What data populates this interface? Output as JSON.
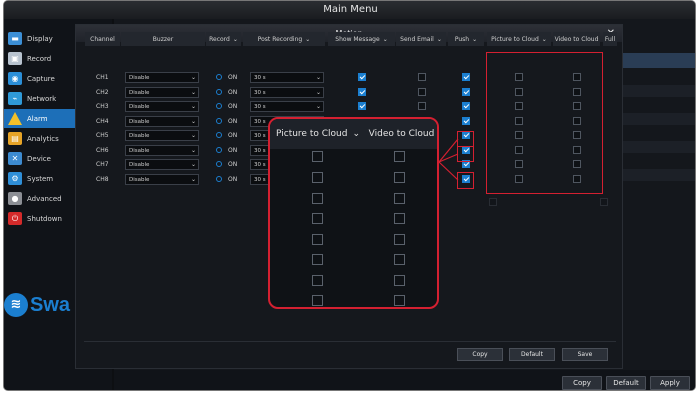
{
  "window_title": "Main Menu",
  "sidebar": {
    "items": [
      {
        "label": "Display",
        "icon": "display-icon",
        "color": "#3c8fd6",
        "active": false
      },
      {
        "label": "Record",
        "icon": "record-icon",
        "color": "#b8c3cf",
        "active": false
      },
      {
        "label": "Capture",
        "icon": "camera-icon",
        "color": "#2b8fd8",
        "active": false
      },
      {
        "label": "Network",
        "icon": "network-icon",
        "color": "#2f9ad8",
        "active": false
      },
      {
        "label": "Alarm",
        "icon": "warning-icon",
        "color": "#f3c02a",
        "active": true
      },
      {
        "label": "Analytics",
        "icon": "analytics-icon",
        "color": "#e7a427",
        "active": false
      },
      {
        "label": "Device",
        "icon": "device-icon",
        "color": "#3d8bd0",
        "active": false
      },
      {
        "label": "System",
        "icon": "gear-icon",
        "color": "#2f8fd8",
        "active": false
      },
      {
        "label": "Advanced",
        "icon": "user-icon",
        "color": "#8c8f95",
        "active": false
      },
      {
        "label": "Shutdown",
        "icon": "power-icon",
        "color": "#d42a2a",
        "active": false
      }
    ],
    "logo_text": "Swa"
  },
  "bottom": {
    "copy": "Copy",
    "default": "Default",
    "apply": "Apply"
  },
  "dialog": {
    "title": "Motion",
    "columns": {
      "channel": "Channel",
      "buzzer": "Buzzer",
      "record": "Record",
      "post_recording": "Post Recording",
      "show_message": "Show Message",
      "send_email": "Send Email",
      "push": "Push",
      "picture_to_cloud": "Picture to Cloud",
      "video_to_cloud": "Video to Cloud",
      "full": "Full"
    },
    "rows": [
      {
        "channel": "CH1",
        "buzzer": "Disable",
        "record": "ON",
        "post": "30 s",
        "show_message": true,
        "push": true
      },
      {
        "channel": "CH2",
        "buzzer": "Disable",
        "record": "ON",
        "post": "30 s",
        "show_message": true,
        "push": true
      },
      {
        "channel": "CH3",
        "buzzer": "Disable",
        "record": "ON",
        "post": "30 s",
        "show_message": true,
        "push": true
      },
      {
        "channel": "CH4",
        "buzzer": "Disable",
        "record": "ON",
        "post": "30 s",
        "show_message": false,
        "push": true
      },
      {
        "channel": "CH5",
        "buzzer": "Disable",
        "record": "ON",
        "post": "30 s",
        "show_message": false,
        "push": true
      },
      {
        "channel": "CH6",
        "buzzer": "Disable",
        "record": "ON",
        "post": "30 s",
        "show_message": false,
        "push": true
      },
      {
        "channel": "CH7",
        "buzzer": "Disable",
        "record": "ON",
        "post": "30 s",
        "show_message": false,
        "push": true
      },
      {
        "channel": "CH8",
        "buzzer": "Disable",
        "record": "ON",
        "post": "30 s",
        "show_message": true,
        "push": true
      }
    ],
    "buttons": {
      "copy": "Copy",
      "default": "Default",
      "save": "Save"
    }
  },
  "zoom": {
    "picture_to_cloud": "Picture to Cloud",
    "video_to_cloud": "Video to Cloud",
    "row_count": 8
  },
  "colors": {
    "accent": "#1b7fd0",
    "highlight": "#d42031"
  }
}
